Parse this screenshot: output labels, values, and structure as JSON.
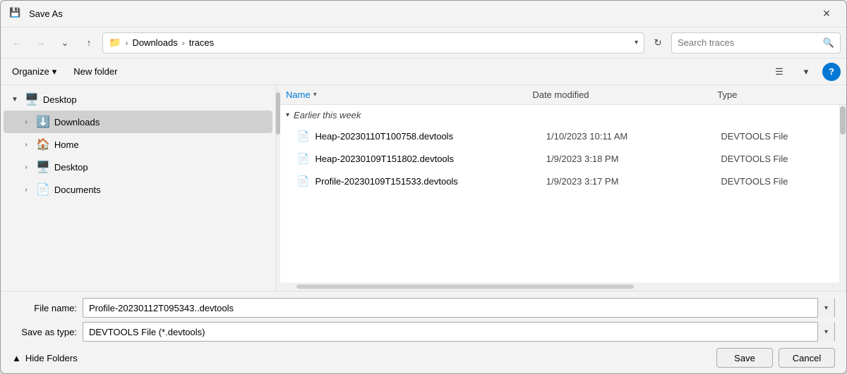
{
  "dialog": {
    "title": "Save As",
    "icon": "📁"
  },
  "titlebar": {
    "close_label": "✕"
  },
  "navbar": {
    "back_tooltip": "Back",
    "forward_tooltip": "Forward",
    "dropdown_tooltip": "Recent locations",
    "up_tooltip": "Up",
    "address": {
      "folder_icon": "📁",
      "parts": [
        "Downloads",
        "traces"
      ],
      "dropdown_label": "▾"
    },
    "refresh_label": "↻",
    "search_placeholder": "Search traces",
    "search_icon": "🔍"
  },
  "toolbar": {
    "organize_label": "Organize",
    "organize_arrow": "▾",
    "new_folder_label": "New folder",
    "view_icon": "☰",
    "view_dropdown": "▾",
    "help_label": "?"
  },
  "sidebar": {
    "items": [
      {
        "id": "desktop-expand",
        "expanded": true,
        "indent": 0,
        "icon": "🖥️",
        "label": "Desktop",
        "chevron": "▼"
      },
      {
        "id": "downloads",
        "expanded": false,
        "indent": 1,
        "icon": "⬇️",
        "label": "Downloads",
        "chevron": "›",
        "selected": true
      },
      {
        "id": "home",
        "expanded": false,
        "indent": 1,
        "icon": "🏠",
        "label": "Home",
        "chevron": "›"
      },
      {
        "id": "desktop2",
        "expanded": false,
        "indent": 1,
        "icon": "🖥️",
        "label": "Desktop",
        "chevron": "›"
      },
      {
        "id": "documents",
        "expanded": false,
        "indent": 1,
        "icon": "📄",
        "label": "Documents",
        "chevron": "›"
      }
    ]
  },
  "file_list": {
    "columns": {
      "name": "Name",
      "date": "Date modified",
      "type": "Type"
    },
    "groups": [
      {
        "label": "Earlier this week",
        "files": [
          {
            "name": "Heap-20230110T100758.devtools",
            "date": "1/10/2023 10:11 AM",
            "type": "DEVTOOLS File"
          },
          {
            "name": "Heap-20230109T151802.devtools",
            "date": "1/9/2023 3:18 PM",
            "type": "DEVTOOLS File"
          },
          {
            "name": "Profile-20230109T151533.devtools",
            "date": "1/9/2023 3:17 PM",
            "type": "DEVTOOLS File"
          }
        ]
      }
    ]
  },
  "bottom": {
    "filename_label": "File name:",
    "filename_value": "Profile-20230112T095343..devtools",
    "filetype_label": "Save as type:",
    "filetype_value": "DEVTOOLS File (*.devtools)",
    "hide_folders_label": "Hide Folders",
    "hide_chevron": "▲",
    "save_label": "Save",
    "cancel_label": "Cancel"
  }
}
